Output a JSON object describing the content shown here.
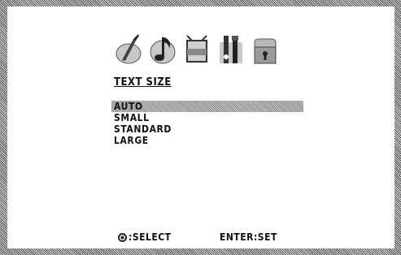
{
  "menu": {
    "icons": [
      {
        "name": "picture-icon"
      },
      {
        "name": "sound-icon"
      },
      {
        "name": "channel-icon"
      },
      {
        "name": "setup-icon"
      },
      {
        "name": "lock-icon"
      }
    ],
    "section_title": "TEXT SIZE",
    "options": [
      "AUTO",
      "SMALL",
      "STANDARD",
      "LARGE"
    ],
    "selected_option": "AUTO"
  },
  "footer": {
    "select_label": ":SELECT",
    "set_label": "ENTER:SET"
  }
}
